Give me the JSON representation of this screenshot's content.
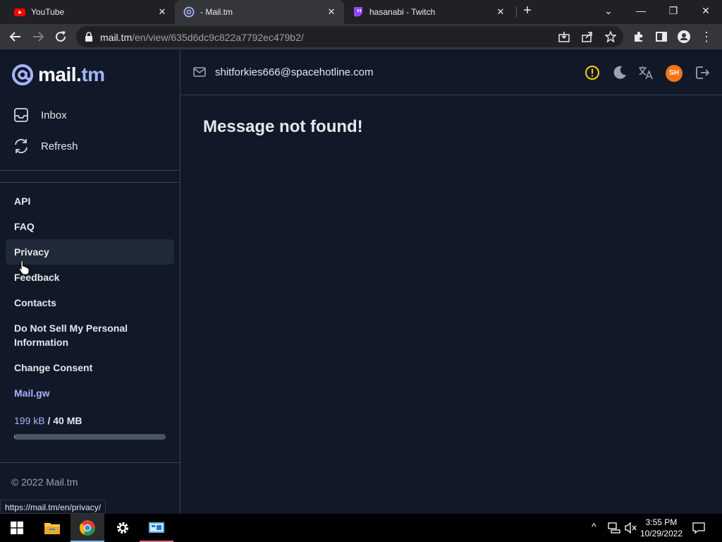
{
  "browser": {
    "tabs": [
      {
        "title": "YouTube",
        "icon": "youtube-icon"
      },
      {
        "title": "- Mail.tm",
        "icon": "mailtm-icon",
        "active": true
      },
      {
        "title": "hasanabi - Twitch",
        "icon": "twitch-icon"
      }
    ],
    "url_host": "mail.tm",
    "url_path": "/en/view/635d6dc9c822a7792ec479b2/",
    "status_url": "https://mail.tm/en/privacy/"
  },
  "sidebar": {
    "logo_main": "mail.",
    "logo_accent": "tm",
    "nav": [
      {
        "label": "Inbox",
        "icon": "inbox-icon"
      },
      {
        "label": "Refresh",
        "icon": "refresh-icon"
      }
    ],
    "links": [
      {
        "label": "API"
      },
      {
        "label": "FAQ"
      },
      {
        "label": "Privacy"
      },
      {
        "label": "Feedback"
      },
      {
        "label": "Contacts"
      },
      {
        "label": "Do Not Sell My Personal Information"
      },
      {
        "label": "Change Consent"
      },
      {
        "label": "Mail.gw"
      }
    ],
    "storage_used": "199 kB",
    "storage_total": "/ 40 MB",
    "storage_fraction": 0.005,
    "copyright": "© 2022 Mail.tm"
  },
  "header": {
    "email": "shitforkies666@spacehotline.com",
    "avatar_initials": "SH"
  },
  "main": {
    "message": "Message not found!"
  },
  "taskbar": {
    "time": "3:55 PM",
    "date": "10/29/2022"
  },
  "colors": {
    "accent": "#a5b4fc",
    "background": "#111827",
    "avatar": "#f97316",
    "warning": "#facc15"
  }
}
